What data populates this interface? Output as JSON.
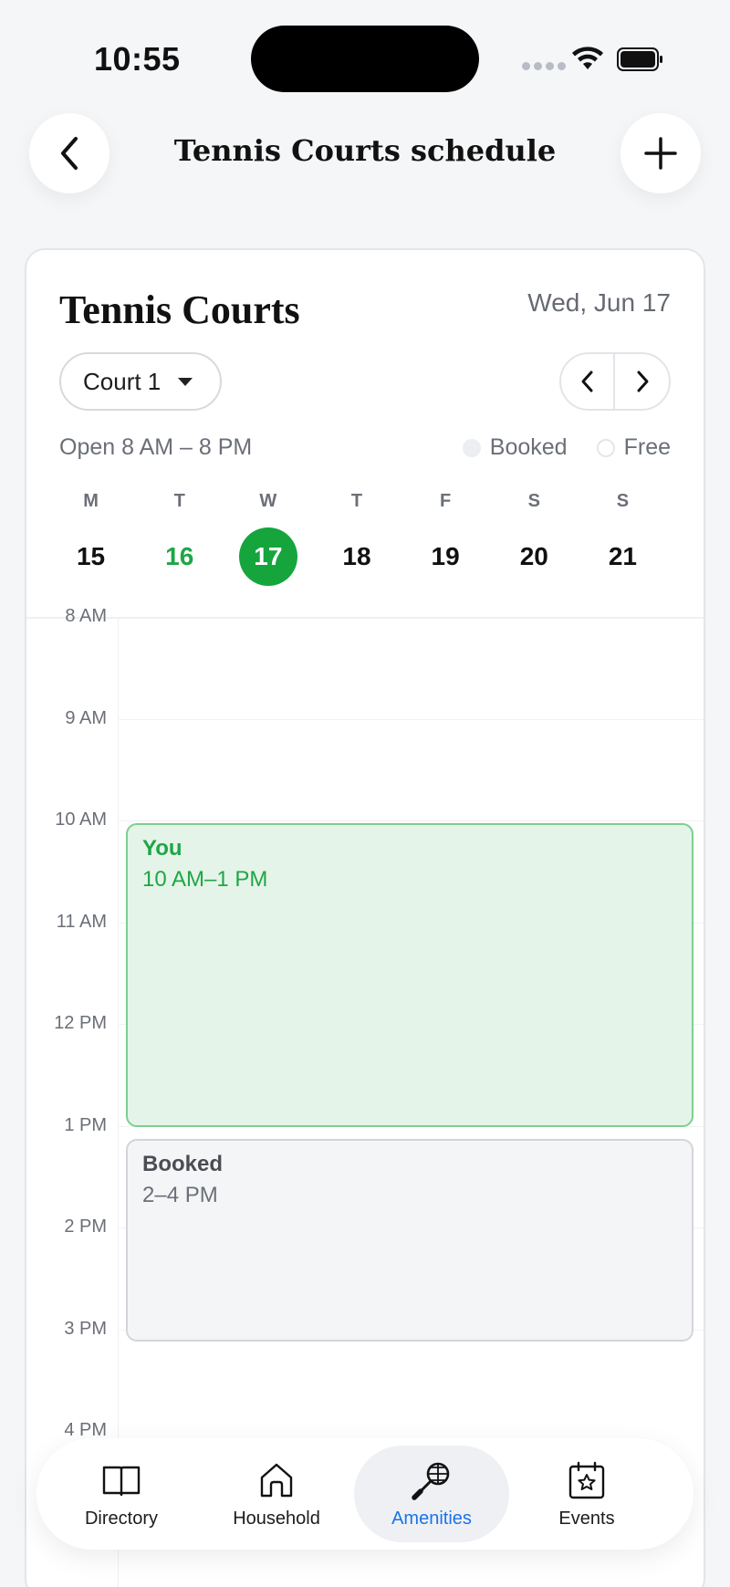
{
  "status_bar": {
    "time": "10:55"
  },
  "header": {
    "title": "Tennis Courts schedule",
    "back_icon": "chevron-left-icon",
    "add_icon": "plus-icon"
  },
  "card": {
    "title": "Tennis Courts",
    "date": "Wed, Jun 17",
    "court_select": {
      "value": "Court 1"
    },
    "hours": "Open 8 AM – 8 PM",
    "legend": {
      "booked": "Booked",
      "free": "Free"
    },
    "week": [
      {
        "dow": "M",
        "num": "15"
      },
      {
        "dow": "T",
        "num": "16"
      },
      {
        "dow": "W",
        "num": "17"
      },
      {
        "dow": "T",
        "num": "18"
      },
      {
        "dow": "F",
        "num": "19"
      },
      {
        "dow": "S",
        "num": "20"
      },
      {
        "dow": "S",
        "num": "21"
      }
    ]
  },
  "schedule": {
    "hours": [
      "8 AM",
      "9 AM",
      "10 AM",
      "11 AM",
      "12 PM",
      "1 PM",
      "2 PM",
      "3 PM",
      "4 PM"
    ],
    "events": [
      {
        "title": "You",
        "time": "10 AM–1 PM"
      },
      {
        "title": "Booked",
        "time": "2–4 PM"
      }
    ]
  },
  "tabbar": {
    "tabs": [
      {
        "label": "Directory",
        "icon": "book-icon"
      },
      {
        "label": "Household",
        "icon": "home-icon"
      },
      {
        "label": "Amenities",
        "icon": "tennis-racket-icon",
        "active": true
      },
      {
        "label": "Events",
        "icon": "calendar-star-icon"
      }
    ]
  },
  "colors": {
    "accent_green": "#16a53c",
    "active_blue": "#1a73e8"
  }
}
